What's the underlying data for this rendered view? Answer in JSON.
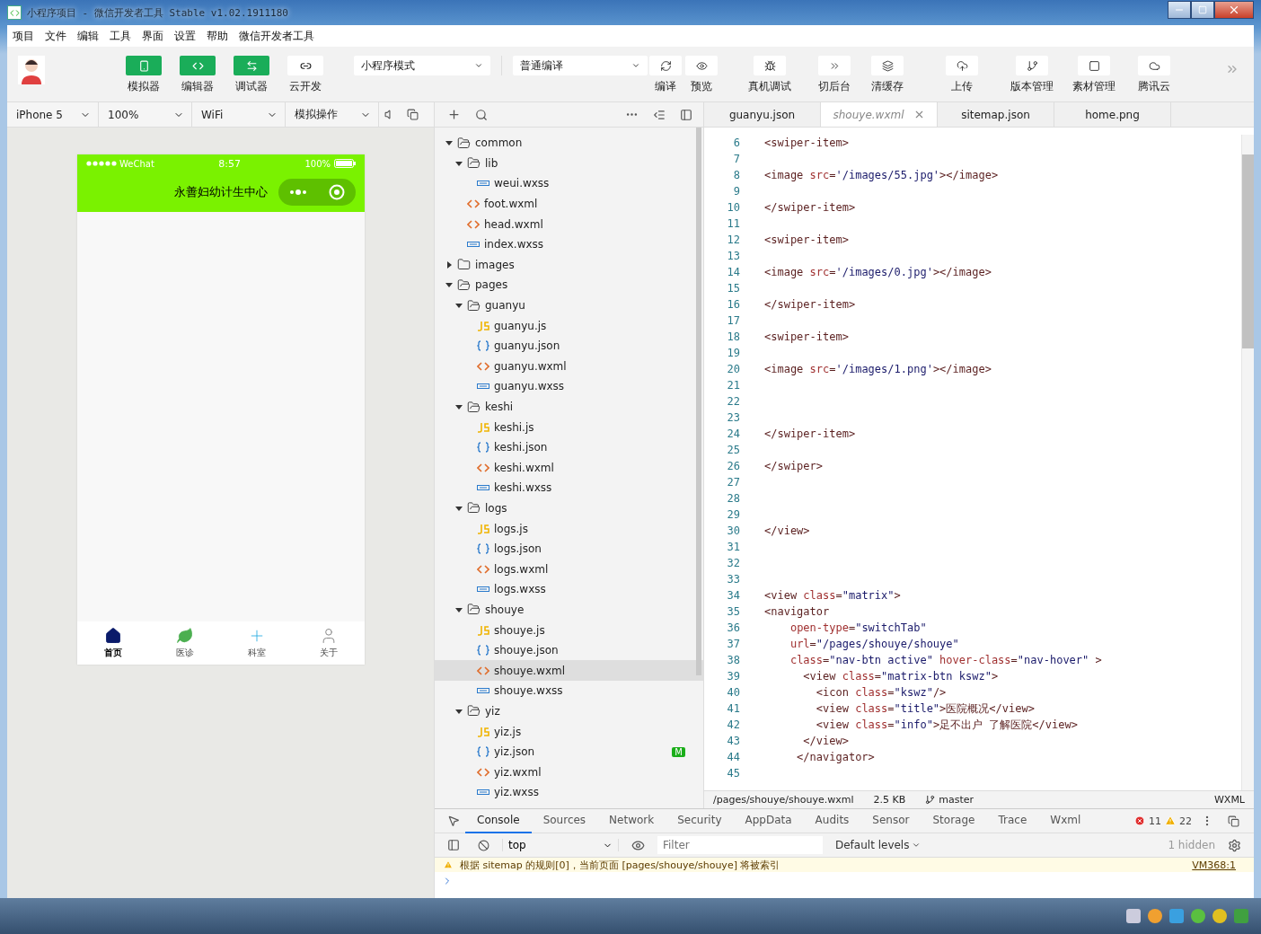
{
  "window": {
    "title": "小程序项目 - 微信开发者工具 Stable v1.02.1911180"
  },
  "menu": [
    "项目",
    "文件",
    "编辑",
    "工具",
    "界面",
    "设置",
    "帮助",
    "微信开发者工具"
  ],
  "toolbar": {
    "views": [
      {
        "label": "模拟器",
        "on": true
      },
      {
        "label": "编辑器",
        "on": true
      },
      {
        "label": "调试器",
        "on": true
      },
      {
        "label": "云开发",
        "on": false
      }
    ],
    "mode": "小程序模式",
    "compile_mode": "普通编译",
    "actions": [
      "编译",
      "预览",
      "真机调试",
      "切后台",
      "清缓存",
      "上传",
      "版本管理",
      "素材管理",
      "腾讯云"
    ]
  },
  "simulator": {
    "device": "iPhone 5",
    "zoom": "100%",
    "network": "WiFi",
    "operation": "模拟操作",
    "phone": {
      "carrier": "WeChat",
      "time": "8:57",
      "battery": "100%",
      "title": "永善妇幼计生中心",
      "tabs": [
        {
          "label": "首页",
          "selected": true
        },
        {
          "label": "医诊",
          "selected": false
        },
        {
          "label": "科室",
          "selected": false
        },
        {
          "label": "关于",
          "selected": false
        }
      ]
    }
  },
  "file_tree": [
    {
      "name": "common",
      "kind": "folder",
      "expanded": true,
      "selected": false,
      "children": [
        {
          "name": "lib",
          "kind": "folder",
          "expanded": true,
          "selected": false,
          "children": [
            {
              "name": "weui.wxss",
              "kind": "wxss",
              "selected": false
            }
          ]
        },
        {
          "name": "foot.wxml",
          "kind": "wxml",
          "selected": false
        },
        {
          "name": "head.wxml",
          "kind": "wxml",
          "selected": false
        },
        {
          "name": "index.wxss",
          "kind": "wxss",
          "selected": false
        }
      ]
    },
    {
      "name": "images",
      "kind": "folder",
      "expanded": false,
      "selected": false
    },
    {
      "name": "pages",
      "kind": "folder",
      "expanded": true,
      "selected": false,
      "children": [
        {
          "name": "guanyu",
          "kind": "folder",
          "expanded": true,
          "selected": false,
          "children": [
            {
              "name": "guanyu.js",
              "kind": "js",
              "selected": false
            },
            {
              "name": "guanyu.json",
              "kind": "json",
              "selected": false
            },
            {
              "name": "guanyu.wxml",
              "kind": "wxml",
              "selected": false
            },
            {
              "name": "guanyu.wxss",
              "kind": "wxss",
              "selected": false
            }
          ]
        },
        {
          "name": "keshi",
          "kind": "folder",
          "expanded": true,
          "selected": false,
          "children": [
            {
              "name": "keshi.js",
              "kind": "js",
              "selected": false
            },
            {
              "name": "keshi.json",
              "kind": "json",
              "selected": false
            },
            {
              "name": "keshi.wxml",
              "kind": "wxml",
              "selected": false
            },
            {
              "name": "keshi.wxss",
              "kind": "wxss",
              "selected": false
            }
          ]
        },
        {
          "name": "logs",
          "kind": "folder",
          "expanded": true,
          "selected": false,
          "children": [
            {
              "name": "logs.js",
              "kind": "js",
              "selected": false
            },
            {
              "name": "logs.json",
              "kind": "json",
              "selected": false
            },
            {
              "name": "logs.wxml",
              "kind": "wxml",
              "selected": false
            },
            {
              "name": "logs.wxss",
              "kind": "wxss",
              "selected": false
            }
          ]
        },
        {
          "name": "shouye",
          "kind": "folder",
          "expanded": true,
          "selected": false,
          "children": [
            {
              "name": "shouye.js",
              "kind": "js",
              "selected": false
            },
            {
              "name": "shouye.json",
              "kind": "json",
              "selected": false
            },
            {
              "name": "shouye.wxml",
              "kind": "wxml",
              "selected": true
            },
            {
              "name": "shouye.wxss",
              "kind": "wxss",
              "selected": false
            }
          ]
        },
        {
          "name": "yiz",
          "kind": "folder",
          "expanded": true,
          "selected": false,
          "children": [
            {
              "name": "yiz.js",
              "kind": "js",
              "selected": false
            },
            {
              "name": "yiz.json",
              "kind": "json",
              "selected": false,
              "badge": "M"
            },
            {
              "name": "yiz.wxml",
              "kind": "wxml",
              "selected": false
            },
            {
              "name": "yiz.wxss",
              "kind": "wxss",
              "selected": false
            }
          ]
        }
      ]
    }
  ],
  "editor": {
    "tabs": [
      {
        "label": "guanyu.json",
        "selected": false
      },
      {
        "label": "shouye.wxml",
        "selected": true
      },
      {
        "label": "sitemap.json",
        "selected": false
      },
      {
        "label": "home.png",
        "selected": false
      }
    ],
    "lines": [
      {
        "number": "6",
        "text": "<swiper-item>"
      },
      {
        "number": "7"
      },
      {
        "number": "8",
        "text": "<image src='/images/55.jpg'></image>"
      },
      {
        "number": "9"
      },
      {
        "number": "10",
        "text": "</swiper-item>"
      },
      {
        "number": "11"
      },
      {
        "number": "12",
        "text": "<swiper-item>"
      },
      {
        "number": "13"
      },
      {
        "number": "14",
        "text": "<image src='/images/0.jpg'></image>"
      },
      {
        "number": "15"
      },
      {
        "number": "16",
        "text": "</swiper-item>"
      },
      {
        "number": "17"
      },
      {
        "number": "18",
        "text": "<swiper-item>"
      },
      {
        "number": "19"
      },
      {
        "number": "20",
        "text": "<image src='/images/1.png'></image>"
      },
      {
        "number": "21"
      },
      {
        "number": "22"
      },
      {
        "number": "23"
      },
      {
        "number": "24",
        "text": "</swiper-item>"
      },
      {
        "number": "25"
      },
      {
        "number": "26",
        "text": "</swiper>"
      },
      {
        "number": "27"
      },
      {
        "number": "28"
      },
      {
        "number": "29"
      },
      {
        "number": "30",
        "text": "</view>"
      },
      {
        "number": "31"
      },
      {
        "number": "32"
      },
      {
        "number": "33"
      },
      {
        "number": "34",
        "text": "<view class=\"matrix\">"
      },
      {
        "number": "35",
        "text": "<navigator"
      },
      {
        "number": "36",
        "text": "    open-type=\"switchTab\""
      },
      {
        "number": "37",
        "text": "    url=\"/pages/shouye/shouye\""
      },
      {
        "number": "38",
        "text": "    class=\"nav-btn active\" hover-class=\"nav-hover\" >"
      },
      {
        "number": "39",
        "text": "      <view class=\"matrix-btn kswz\">"
      },
      {
        "number": "40",
        "text": "        <icon class=\"kswz\"/>"
      },
      {
        "number": "41",
        "text": "        <view class=\"title\">医院概况</view>"
      },
      {
        "number": "42",
        "text": "        <view class=\"info\">足不出户 了解医院</view>"
      },
      {
        "number": "43",
        "text": "      </view>"
      },
      {
        "number": "44",
        "text": "     </navigator>"
      },
      {
        "number": "45"
      }
    ],
    "status": {
      "path": "/pages/shouye/shouye.wxml",
      "size": "2.5 KB",
      "branch": "master",
      "language": "WXML"
    }
  },
  "devtools": {
    "tabs": [
      {
        "label": "Console",
        "selected": true
      },
      {
        "label": "Sources",
        "selected": false
      },
      {
        "label": "Network",
        "selected": false
      },
      {
        "label": "Security",
        "selected": false
      },
      {
        "label": "AppData",
        "selected": false
      },
      {
        "label": "Audits",
        "selected": false
      },
      {
        "label": "Sensor",
        "selected": false
      },
      {
        "label": "Storage",
        "selected": false
      },
      {
        "label": "Trace",
        "selected": false
      },
      {
        "label": "Wxml",
        "selected": false
      }
    ],
    "errors": "11",
    "warnings": "22",
    "context": "top",
    "filter_placeholder": "Filter",
    "levels": "Default levels",
    "hidden": "1 hidden",
    "messages": [
      {
        "kind": "warning",
        "text": "根据 sitemap 的规则[0]，当前页面 [pages/shouye/shouye] 将被索引",
        "source": "VM368:1"
      }
    ]
  }
}
